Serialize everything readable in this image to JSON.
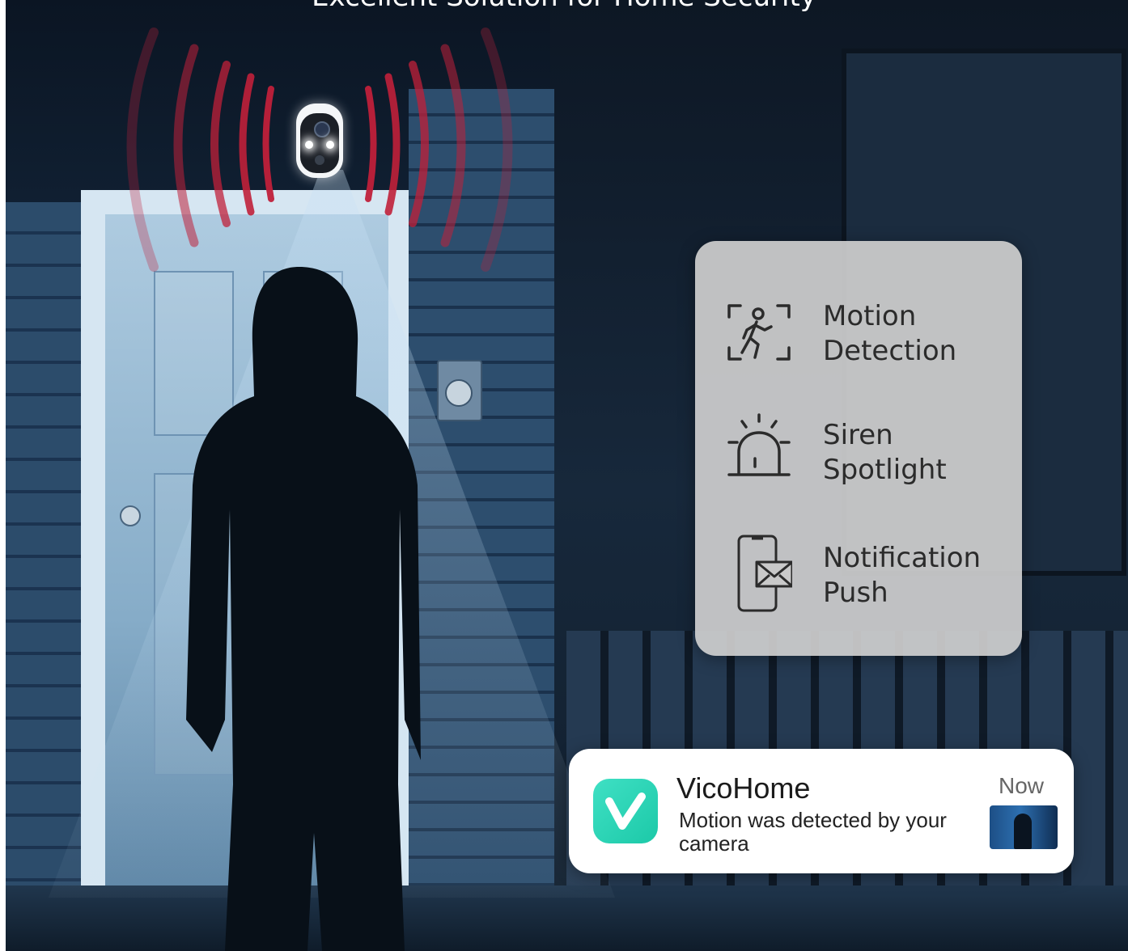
{
  "headline": "Excellent Solution for Home Security",
  "features": [
    {
      "icon": "motion-detection-icon",
      "line1": "Motion",
      "line2": "Detection"
    },
    {
      "icon": "siren-icon",
      "line1": "Siren",
      "line2": "Spotlight"
    },
    {
      "icon": "phone-notification-icon",
      "line1": "Notification",
      "line2": "Push"
    }
  ],
  "notification": {
    "app_name": "VicoHome",
    "time": "Now",
    "message": "Motion was detected by your camera"
  },
  "colors": {
    "siren_wave": "#c0203a",
    "app_icon": "#2ad4b4",
    "card_background": "#cdcdcd"
  }
}
